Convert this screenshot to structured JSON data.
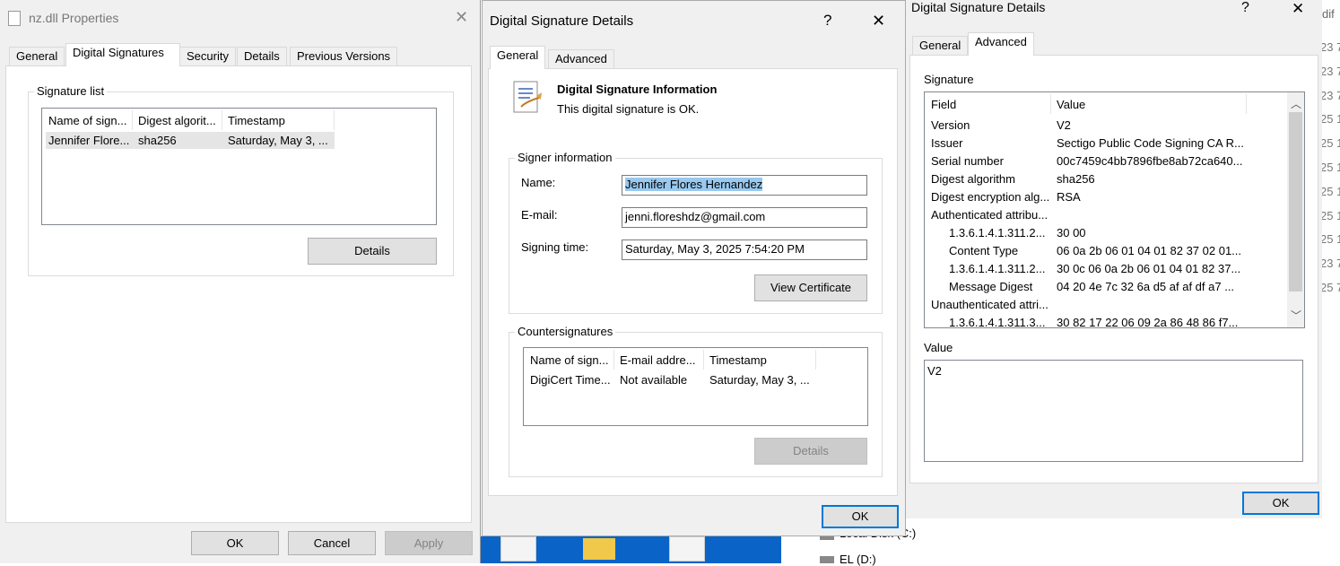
{
  "background_strip": {
    "right_text": "dif",
    "right_numbers": [
      "23 7",
      "23 7",
      "23 7",
      "25 1",
      "25 1",
      "25 1",
      "25 1",
      "25 1",
      "25 1",
      "23 7",
      "25 7"
    ],
    "drive_labels": [
      "Local Disk (C:)",
      "EL (D:)"
    ]
  },
  "props_window": {
    "title": "nz.dll Properties",
    "tabs": [
      "General",
      "Digital Signatures",
      "Security",
      "Details",
      "Previous Versions"
    ],
    "active_tab": 1,
    "group_label": "Signature list",
    "columns": [
      "Name of sign...",
      "Digest algorit...",
      "Timestamp"
    ],
    "rows": [
      [
        "Jennifer Flore...",
        "sha256",
        "Saturday, May 3, ..."
      ]
    ],
    "details_button": "Details",
    "ok_button": "OK",
    "cancel_button": "Cancel",
    "apply_button": "Apply"
  },
  "dsd_general": {
    "title": "Digital Signature Details",
    "help": "?",
    "close": "✕",
    "tabs": [
      "General",
      "Advanced"
    ],
    "info_title": "Digital Signature Information",
    "info_status": "This digital signature is OK.",
    "signer_group": "Signer information",
    "name_label": "Name:",
    "name_value": "Jennifer Flores Hernandez",
    "email_label": "E-mail:",
    "email_value": "jenni.floreshdz@gmail.com",
    "time_label": "Signing time:",
    "time_value": "Saturday, May 3, 2025 7:54:20 PM",
    "view_cert_button": "View Certificate",
    "counter_group": "Countersignatures",
    "counter_columns": [
      "Name of sign...",
      "E-mail addre...",
      "Timestamp"
    ],
    "counter_rows": [
      [
        "DigiCert Time...",
        "Not available",
        "Saturday, May 3, ..."
      ]
    ],
    "details_button": "Details",
    "ok_button": "OK"
  },
  "dsd_advanced": {
    "title": "Digital Signature Details",
    "help": "?",
    "close": "✕",
    "tabs": [
      "General",
      "Advanced"
    ],
    "signature_label": "Signature",
    "columns": [
      "Field",
      "Value"
    ],
    "rows": [
      {
        "field": "Version",
        "value": "V2",
        "indent": false
      },
      {
        "field": "Issuer",
        "value": "Sectigo Public Code Signing CA R...",
        "indent": false
      },
      {
        "field": "Serial number",
        "value": "00c7459c4bb7896fbe8ab72ca640...",
        "indent": false
      },
      {
        "field": "Digest algorithm",
        "value": "sha256",
        "indent": false
      },
      {
        "field": "Digest encryption alg...",
        "value": "RSA",
        "indent": false
      },
      {
        "field": "Authenticated attribu...",
        "value": "",
        "indent": false
      },
      {
        "field": "1.3.6.1.4.1.311.2...",
        "value": "30 00",
        "indent": true
      },
      {
        "field": "Content Type",
        "value": "06 0a 2b 06 01 04 01 82 37 02 01...",
        "indent": true
      },
      {
        "field": "1.3.6.1.4.1.311.2...",
        "value": "30 0c 06 0a 2b 06 01 04 01 82 37...",
        "indent": true
      },
      {
        "field": "Message Digest",
        "value": "04 20 4e 7c 32 6a d5 af af df a7 ...",
        "indent": true
      },
      {
        "field": "Unauthenticated attri...",
        "value": "",
        "indent": false
      },
      {
        "field": "1.3.6.1.4.1.311.3...",
        "value": "30 82 17 22 06 09 2a 86 48 86 f7...",
        "indent": true
      }
    ],
    "value_label": "Value",
    "value_text": "V2",
    "ok_button": "OK"
  },
  "colors": {
    "accent": "#0078d7",
    "selection": "#99c9ef",
    "taskbar": "#0a64c8"
  }
}
